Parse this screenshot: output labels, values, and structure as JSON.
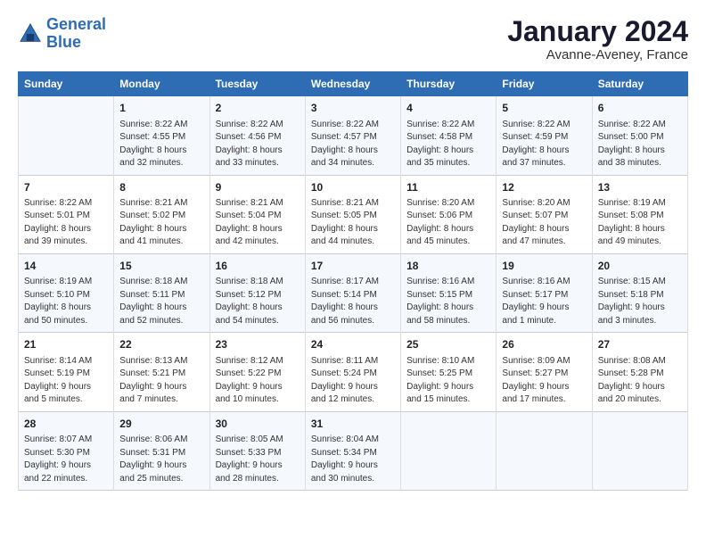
{
  "header": {
    "logo_line1": "General",
    "logo_line2": "Blue",
    "month": "January 2024",
    "location": "Avanne-Aveney, France"
  },
  "weekdays": [
    "Sunday",
    "Monday",
    "Tuesday",
    "Wednesday",
    "Thursday",
    "Friday",
    "Saturday"
  ],
  "weeks": [
    [
      {
        "day": "",
        "sunrise": "",
        "sunset": "",
        "daylight": ""
      },
      {
        "day": "1",
        "sunrise": "Sunrise: 8:22 AM",
        "sunset": "Sunset: 4:55 PM",
        "daylight": "Daylight: 8 hours and 32 minutes."
      },
      {
        "day": "2",
        "sunrise": "Sunrise: 8:22 AM",
        "sunset": "Sunset: 4:56 PM",
        "daylight": "Daylight: 8 hours and 33 minutes."
      },
      {
        "day": "3",
        "sunrise": "Sunrise: 8:22 AM",
        "sunset": "Sunset: 4:57 PM",
        "daylight": "Daylight: 8 hours and 34 minutes."
      },
      {
        "day": "4",
        "sunrise": "Sunrise: 8:22 AM",
        "sunset": "Sunset: 4:58 PM",
        "daylight": "Daylight: 8 hours and 35 minutes."
      },
      {
        "day": "5",
        "sunrise": "Sunrise: 8:22 AM",
        "sunset": "Sunset: 4:59 PM",
        "daylight": "Daylight: 8 hours and 37 minutes."
      },
      {
        "day": "6",
        "sunrise": "Sunrise: 8:22 AM",
        "sunset": "Sunset: 5:00 PM",
        "daylight": "Daylight: 8 hours and 38 minutes."
      }
    ],
    [
      {
        "day": "7",
        "sunrise": "Sunrise: 8:22 AM",
        "sunset": "Sunset: 5:01 PM",
        "daylight": "Daylight: 8 hours and 39 minutes."
      },
      {
        "day": "8",
        "sunrise": "Sunrise: 8:21 AM",
        "sunset": "Sunset: 5:02 PM",
        "daylight": "Daylight: 8 hours and 41 minutes."
      },
      {
        "day": "9",
        "sunrise": "Sunrise: 8:21 AM",
        "sunset": "Sunset: 5:04 PM",
        "daylight": "Daylight: 8 hours and 42 minutes."
      },
      {
        "day": "10",
        "sunrise": "Sunrise: 8:21 AM",
        "sunset": "Sunset: 5:05 PM",
        "daylight": "Daylight: 8 hours and 44 minutes."
      },
      {
        "day": "11",
        "sunrise": "Sunrise: 8:20 AM",
        "sunset": "Sunset: 5:06 PM",
        "daylight": "Daylight: 8 hours and 45 minutes."
      },
      {
        "day": "12",
        "sunrise": "Sunrise: 8:20 AM",
        "sunset": "Sunset: 5:07 PM",
        "daylight": "Daylight: 8 hours and 47 minutes."
      },
      {
        "day": "13",
        "sunrise": "Sunrise: 8:19 AM",
        "sunset": "Sunset: 5:08 PM",
        "daylight": "Daylight: 8 hours and 49 minutes."
      }
    ],
    [
      {
        "day": "14",
        "sunrise": "Sunrise: 8:19 AM",
        "sunset": "Sunset: 5:10 PM",
        "daylight": "Daylight: 8 hours and 50 minutes."
      },
      {
        "day": "15",
        "sunrise": "Sunrise: 8:18 AM",
        "sunset": "Sunset: 5:11 PM",
        "daylight": "Daylight: 8 hours and 52 minutes."
      },
      {
        "day": "16",
        "sunrise": "Sunrise: 8:18 AM",
        "sunset": "Sunset: 5:12 PM",
        "daylight": "Daylight: 8 hours and 54 minutes."
      },
      {
        "day": "17",
        "sunrise": "Sunrise: 8:17 AM",
        "sunset": "Sunset: 5:14 PM",
        "daylight": "Daylight: 8 hours and 56 minutes."
      },
      {
        "day": "18",
        "sunrise": "Sunrise: 8:16 AM",
        "sunset": "Sunset: 5:15 PM",
        "daylight": "Daylight: 8 hours and 58 minutes."
      },
      {
        "day": "19",
        "sunrise": "Sunrise: 8:16 AM",
        "sunset": "Sunset: 5:17 PM",
        "daylight": "Daylight: 9 hours and 1 minute."
      },
      {
        "day": "20",
        "sunrise": "Sunrise: 8:15 AM",
        "sunset": "Sunset: 5:18 PM",
        "daylight": "Daylight: 9 hours and 3 minutes."
      }
    ],
    [
      {
        "day": "21",
        "sunrise": "Sunrise: 8:14 AM",
        "sunset": "Sunset: 5:19 PM",
        "daylight": "Daylight: 9 hours and 5 minutes."
      },
      {
        "day": "22",
        "sunrise": "Sunrise: 8:13 AM",
        "sunset": "Sunset: 5:21 PM",
        "daylight": "Daylight: 9 hours and 7 minutes."
      },
      {
        "day": "23",
        "sunrise": "Sunrise: 8:12 AM",
        "sunset": "Sunset: 5:22 PM",
        "daylight": "Daylight: 9 hours and 10 minutes."
      },
      {
        "day": "24",
        "sunrise": "Sunrise: 8:11 AM",
        "sunset": "Sunset: 5:24 PM",
        "daylight": "Daylight: 9 hours and 12 minutes."
      },
      {
        "day": "25",
        "sunrise": "Sunrise: 8:10 AM",
        "sunset": "Sunset: 5:25 PM",
        "daylight": "Daylight: 9 hours and 15 minutes."
      },
      {
        "day": "26",
        "sunrise": "Sunrise: 8:09 AM",
        "sunset": "Sunset: 5:27 PM",
        "daylight": "Daylight: 9 hours and 17 minutes."
      },
      {
        "day": "27",
        "sunrise": "Sunrise: 8:08 AM",
        "sunset": "Sunset: 5:28 PM",
        "daylight": "Daylight: 9 hours and 20 minutes."
      }
    ],
    [
      {
        "day": "28",
        "sunrise": "Sunrise: 8:07 AM",
        "sunset": "Sunset: 5:30 PM",
        "daylight": "Daylight: 9 hours and 22 minutes."
      },
      {
        "day": "29",
        "sunrise": "Sunrise: 8:06 AM",
        "sunset": "Sunset: 5:31 PM",
        "daylight": "Daylight: 9 hours and 25 minutes."
      },
      {
        "day": "30",
        "sunrise": "Sunrise: 8:05 AM",
        "sunset": "Sunset: 5:33 PM",
        "daylight": "Daylight: 9 hours and 28 minutes."
      },
      {
        "day": "31",
        "sunrise": "Sunrise: 8:04 AM",
        "sunset": "Sunset: 5:34 PM",
        "daylight": "Daylight: 9 hours and 30 minutes."
      },
      {
        "day": "",
        "sunrise": "",
        "sunset": "",
        "daylight": ""
      },
      {
        "day": "",
        "sunrise": "",
        "sunset": "",
        "daylight": ""
      },
      {
        "day": "",
        "sunrise": "",
        "sunset": "",
        "daylight": ""
      }
    ]
  ]
}
